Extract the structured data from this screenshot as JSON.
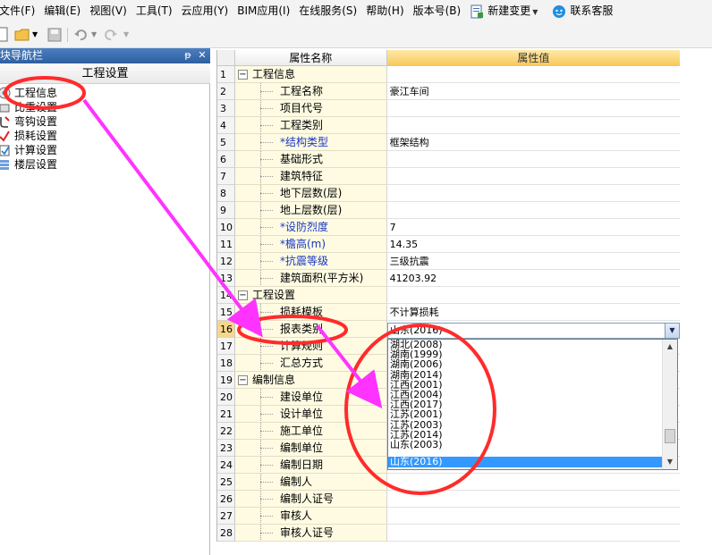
{
  "menubar": {
    "items": [
      "文件(F)",
      "编辑(E)",
      "视图(V)",
      "工具(T)",
      "云应用(Y)",
      "BIM应用(I)",
      "在线服务(S)",
      "帮助(H)",
      "版本号(B)"
    ],
    "new_change": "新建变更",
    "support": "联系客服"
  },
  "left_panel": {
    "title": "块导航栏",
    "pin_glyph": "ᵽ",
    "close_glyph": "✕",
    "header": "工程设置",
    "items": [
      "工程信息",
      "比重设置",
      "弯钩设置",
      "损耗设置",
      "计算设置",
      "楼层设置"
    ]
  },
  "grid": {
    "col_name": "属性名称",
    "col_value": "属性值",
    "rows": [
      {
        "no": "1",
        "name": "工程信息",
        "value": "",
        "group": true
      },
      {
        "no": "2",
        "name": "工程名称",
        "value": "豪江车间"
      },
      {
        "no": "3",
        "name": "项目代号",
        "value": ""
      },
      {
        "no": "4",
        "name": "工程类别",
        "value": ""
      },
      {
        "no": "5",
        "name": "*结构类型",
        "value": "框架结构",
        "required": true
      },
      {
        "no": "6",
        "name": "基础形式",
        "value": ""
      },
      {
        "no": "7",
        "name": "建筑特征",
        "value": ""
      },
      {
        "no": "8",
        "name": "地下层数(层)",
        "value": ""
      },
      {
        "no": "9",
        "name": "地上层数(层)",
        "value": ""
      },
      {
        "no": "10",
        "name": "*设防烈度",
        "value": "7",
        "required": true
      },
      {
        "no": "11",
        "name": "*檐高(m)",
        "value": "14.35",
        "required": true
      },
      {
        "no": "12",
        "name": "*抗震等级",
        "value": "三级抗震",
        "required": true
      },
      {
        "no": "13",
        "name": "建筑面积(平方米)",
        "value": "41203.92"
      },
      {
        "no": "14",
        "name": "工程设置",
        "value": "",
        "group": true
      },
      {
        "no": "15",
        "name": "损耗模板",
        "value": "不计算损耗"
      },
      {
        "no": "16",
        "name": "报表类别",
        "value": "",
        "active": true
      },
      {
        "no": "17",
        "name": "计算规则",
        "value": ""
      },
      {
        "no": "18",
        "name": "汇总方式",
        "value": ""
      },
      {
        "no": "19",
        "name": "编制信息",
        "value": "",
        "group": true
      },
      {
        "no": "20",
        "name": "建设单位",
        "value": ""
      },
      {
        "no": "21",
        "name": "设计单位",
        "value": ""
      },
      {
        "no": "22",
        "name": "施工单位",
        "value": ""
      },
      {
        "no": "23",
        "name": "编制单位",
        "value": ""
      },
      {
        "no": "24",
        "name": "编制日期",
        "value": ""
      },
      {
        "no": "25",
        "name": "编制人",
        "value": ""
      },
      {
        "no": "26",
        "name": "编制人证号",
        "value": ""
      },
      {
        "no": "27",
        "name": "审核人",
        "value": ""
      },
      {
        "no": "28",
        "name": "审核人证号",
        "value": ""
      }
    ]
  },
  "dropdown": {
    "current": "山东(2016)",
    "options": [
      "湖北(2008)",
      "湖南(1999)",
      "湖南(2006)",
      "湖南(2014)",
      "江西(2001)",
      "江西(2004)",
      "江西(2017)",
      "江苏(2001)",
      "江苏(2003)",
      "江苏(2014)",
      "山东(2003)",
      "山东(2016)"
    ],
    "selected_index": 11
  },
  "colors": {
    "annotation_red": "#ff2b2b",
    "annotation_magenta": "#ff33ff",
    "selection_blue": "#3399ff",
    "header_gold": "#f7c95d"
  }
}
